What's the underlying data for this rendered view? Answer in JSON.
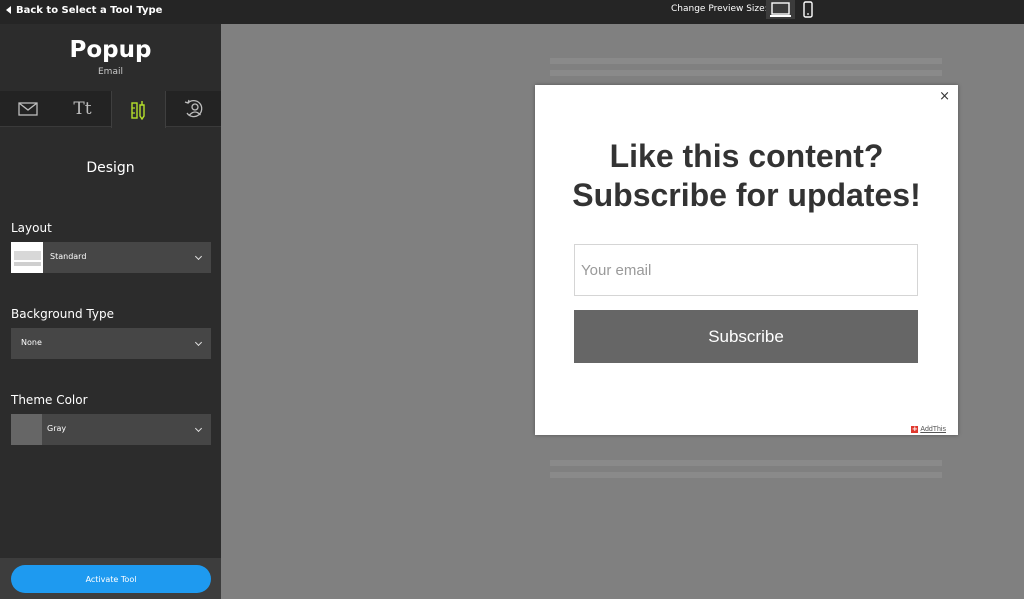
{
  "topbar": {
    "back_label": "Back to Select a Tool Type",
    "preview_label": "Change Preview Size:",
    "devices": [
      "laptop-icon",
      "mobile-icon"
    ]
  },
  "sidebar": {
    "title": "Popup",
    "subtitle": "Email",
    "tabs": [
      "envelope-icon",
      "text-style-icon",
      "design-pencil-icon",
      "user-settings-icon"
    ],
    "tab_text": "Tt",
    "section_title": "Design",
    "layout": {
      "label": "Layout",
      "value": "Standard"
    },
    "background_type": {
      "label": "Background Type",
      "value": "None"
    },
    "theme_color": {
      "label": "Theme Color",
      "value": "Gray",
      "color": "#666666"
    },
    "activate_label": "Activate Tool"
  },
  "popup": {
    "close": "×",
    "headline_line1": "Like this content?",
    "headline_line2": "Subscribe for updates!",
    "email_placeholder": "Your email",
    "subscribe_label": "Subscribe",
    "brand": "AddThis",
    "brand_icon": "+"
  },
  "colors": {
    "accent": "#1e9af0",
    "active_tab_icon": "#b6e12b",
    "brand_red": "#e0382e"
  }
}
